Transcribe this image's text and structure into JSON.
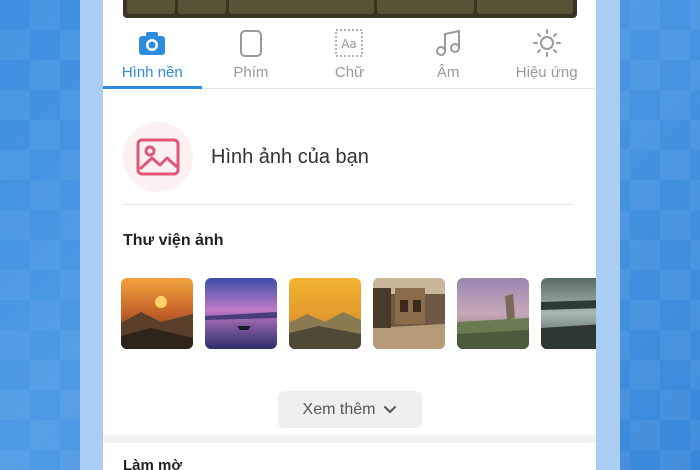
{
  "tabs": [
    {
      "label": "Hình nền",
      "icon": "camera-icon",
      "active": true
    },
    {
      "label": "Phím",
      "icon": "key-icon",
      "active": false
    },
    {
      "label": "Chữ",
      "icon": "font-icon",
      "active": false
    },
    {
      "label": "Âm",
      "icon": "music-note-icon",
      "active": false
    },
    {
      "label": "Hiệu ứng",
      "icon": "sun-icon",
      "active": false
    }
  ],
  "own_photos": {
    "label": "Hình ảnh của bạn",
    "icon": "image-icon"
  },
  "library": {
    "title": "Thư viện ảnh"
  },
  "more_button": {
    "label": "Xem thêm",
    "icon": "chevron-down-icon"
  },
  "blur_section": {
    "title": "Làm mờ"
  },
  "colors": {
    "accent": "#2d8be0",
    "background": "#4a95e3",
    "icon_pink": "#e0577a"
  }
}
